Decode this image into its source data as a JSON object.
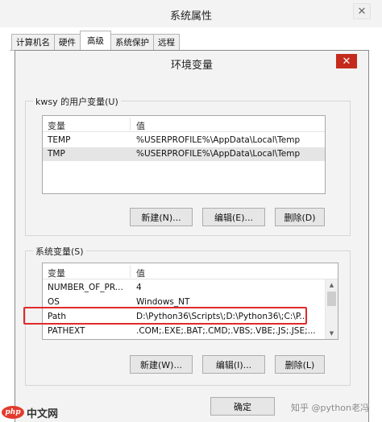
{
  "outer_window": {
    "title": "系统属性",
    "close_glyph": "✕",
    "tabs": [
      {
        "label": "计算机名",
        "active": false
      },
      {
        "label": "硬件",
        "active": false
      },
      {
        "label": "高级",
        "active": true
      },
      {
        "label": "系统保护",
        "active": false
      },
      {
        "label": "远程",
        "active": false
      }
    ]
  },
  "dialog": {
    "title": "环境变量",
    "close_glyph": "✕"
  },
  "user_vars": {
    "group_label": "kwsy 的用户变量(U)",
    "columns": [
      "变量",
      "值"
    ],
    "rows": [
      {
        "name": "TEMP",
        "value": "%USERPROFILE%\\AppData\\Local\\Temp"
      },
      {
        "name": "TMP",
        "value": "%USERPROFILE%\\AppData\\Local\\Temp"
      }
    ],
    "buttons": {
      "new": "新建(N)...",
      "edit": "编辑(E)...",
      "delete": "删除(D)"
    }
  },
  "system_vars": {
    "group_label": "系统变量(S)",
    "columns": [
      "变量",
      "值"
    ],
    "rows": [
      {
        "name": "NUMBER_OF_PR...",
        "value": "4"
      },
      {
        "name": "OS",
        "value": "Windows_NT"
      },
      {
        "name": "Path",
        "value": "D:\\Python36\\Scripts\\;D:\\Python36\\;C:\\P..."
      },
      {
        "name": "PATHEXT",
        "value": ".COM;.EXE;.BAT;.CMD;.VBS;.VBE;.JS;.JSE;..."
      }
    ],
    "buttons": {
      "new": "新建(W)...",
      "edit": "编辑(I)...",
      "delete": "删除(L)"
    }
  },
  "footer": {
    "ok": "确定"
  },
  "watermarks": {
    "zhihu": "知乎 @python老冯",
    "php_logo": "php",
    "php_text": "中文网"
  },
  "colors": {
    "highlight": "#e02a2a",
    "close_red": "#c42b1c"
  }
}
